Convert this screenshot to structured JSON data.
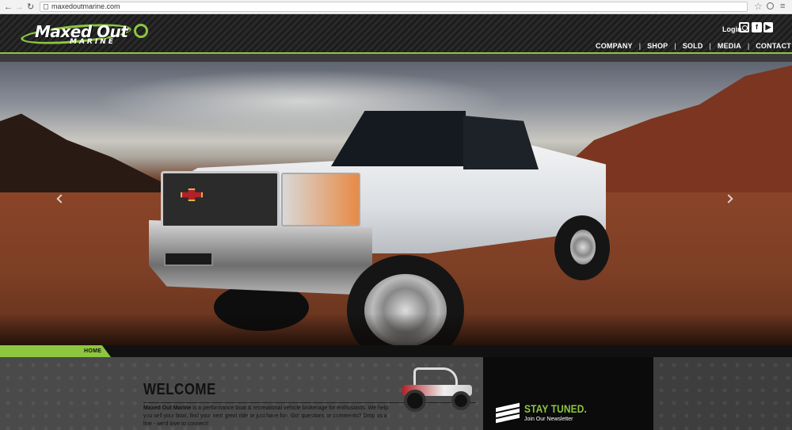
{
  "browser": {
    "url": "maxedoutmarine.com"
  },
  "logo": {
    "word1": "Maxed Out",
    "word2": "MARINE"
  },
  "header": {
    "login_label": "Login",
    "social": [
      "instagram-icon",
      "facebook-icon",
      "youtube-icon"
    ],
    "fb_glyph": "f",
    "yt_glyph": "▶"
  },
  "nav": {
    "items": [
      "COMPANY",
      "SHOP",
      "SOLD",
      "MEDIA",
      "CONTACT"
    ],
    "separator": "|"
  },
  "breadcrumb": {
    "label": "HOME"
  },
  "welcome": {
    "title": "WELCOME",
    "brand": "Maxed Out Marine",
    "body": " is a performance boat & recreational vehicle brokerage for enthusiasts. We help you sell your boat, find your next great ride or just have fun. Got questions or comments? Drop us a line - we'd love to connect!"
  },
  "newsletter": {
    "title": "STAY TUNED.",
    "subtitle": "Join Our Newsletter"
  },
  "colors": {
    "accent": "#8dc63f",
    "header_bg": "#222222",
    "content_bg": "#4a4a4a",
    "newsletter_bg": "#0b0b0b"
  }
}
